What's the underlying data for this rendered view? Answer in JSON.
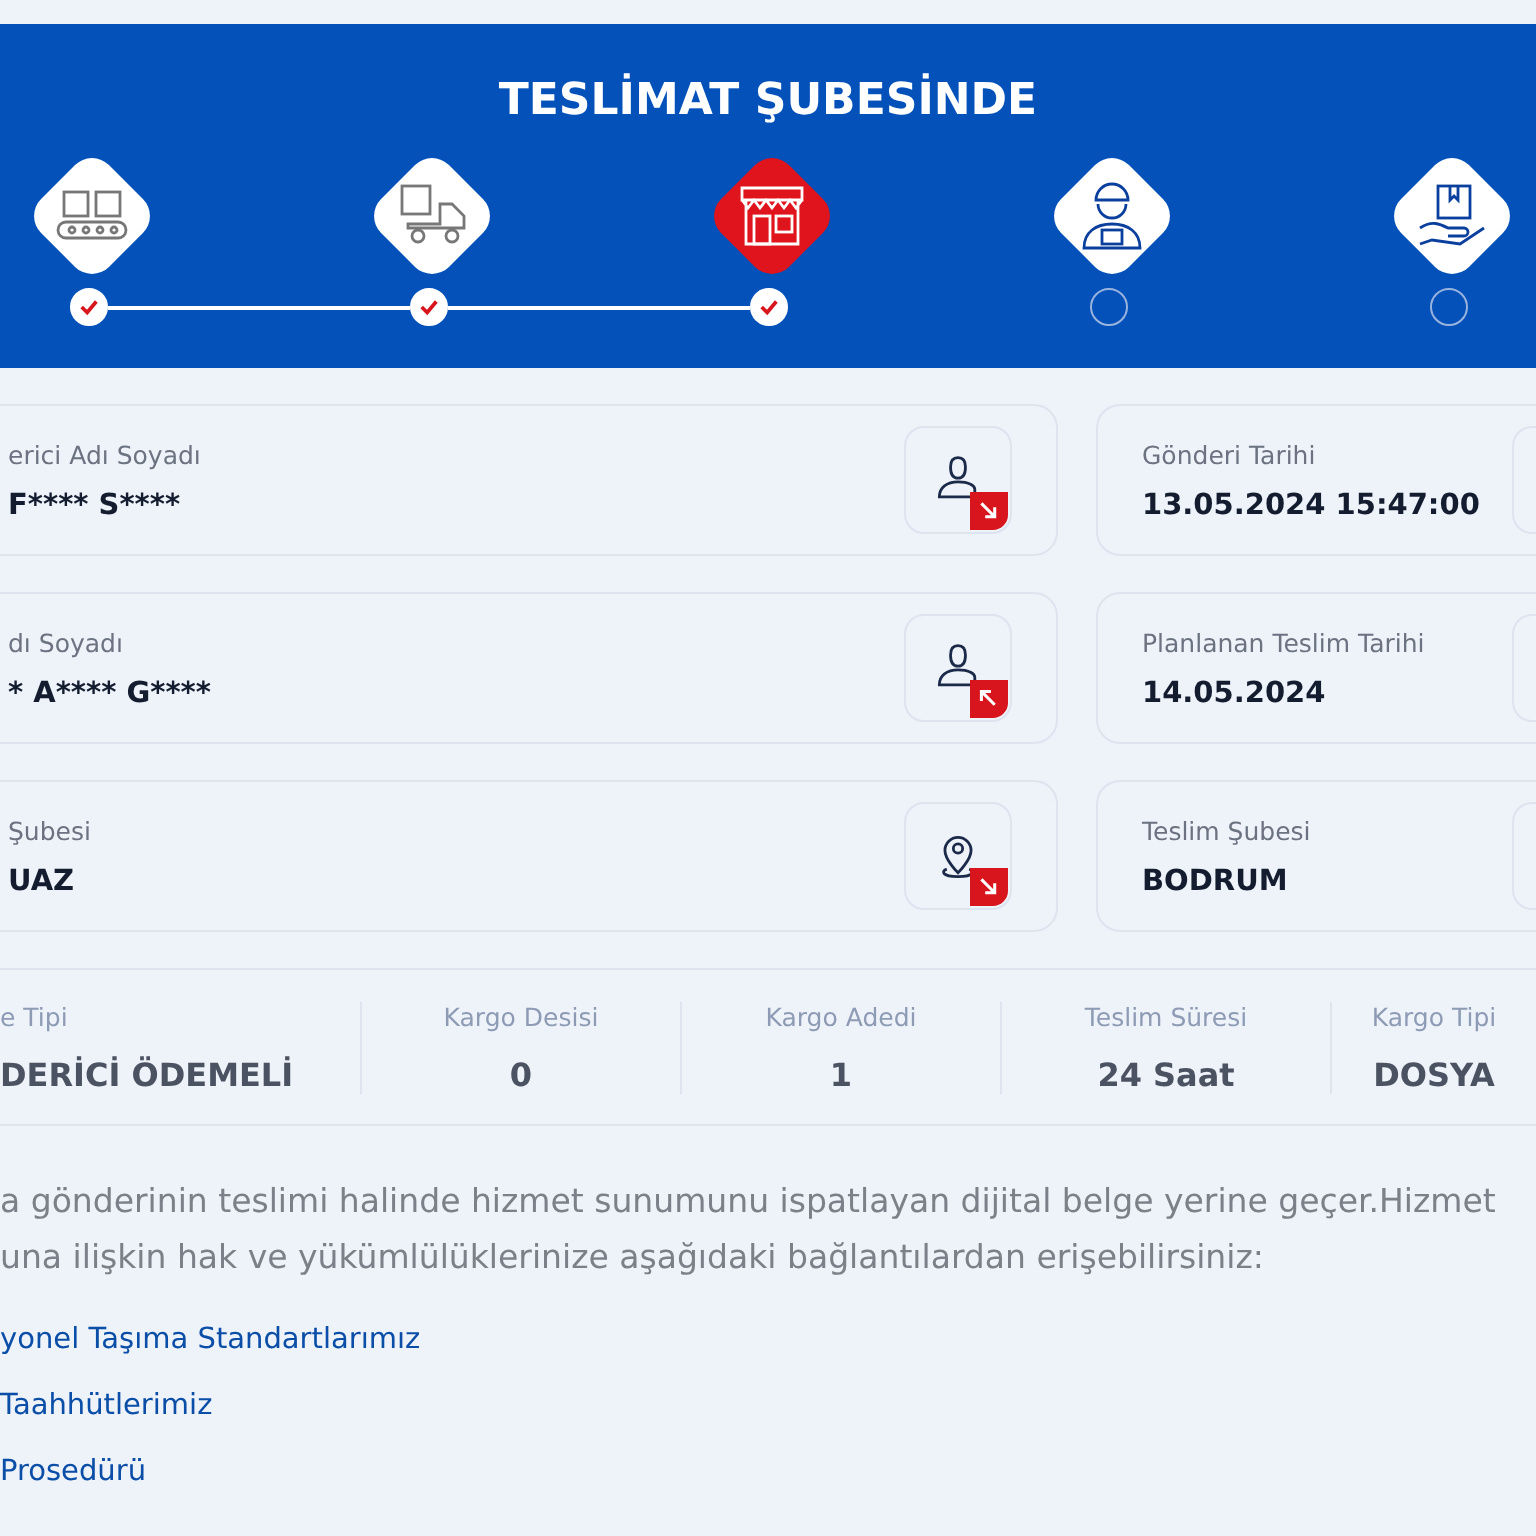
{
  "banner": {
    "title": "TESLİMAT ŞUBESİNDE"
  },
  "steps": [
    {
      "kind": "conveyor",
      "done": true,
      "current": false
    },
    {
      "kind": "truck",
      "done": true,
      "current": false
    },
    {
      "kind": "store",
      "done": true,
      "current": true
    },
    {
      "kind": "courier",
      "done": false,
      "current": false
    },
    {
      "kind": "hand-box",
      "done": false,
      "current": false
    }
  ],
  "left_cards": [
    {
      "label": "erici Adı Soyadı",
      "value": "F**** S****",
      "kind": "sender"
    },
    {
      "label": "dı Soyadı",
      "value": "* A**** G****",
      "kind": "receiver"
    },
    {
      "label": "Şubesi",
      "value": "UAZ",
      "kind": "branch"
    }
  ],
  "right_cards": [
    {
      "label": "Gönderi Tarihi",
      "value": "13.05.2024 15:47:00"
    },
    {
      "label": "Planlanan Teslim Tarihi",
      "value": "14.05.2024"
    },
    {
      "label": "Teslim Şubesi",
      "value": "BODRUM"
    }
  ],
  "stats": [
    {
      "label": "e Tipi",
      "value": "DERİCİ ÖDEMELİ"
    },
    {
      "label": "Kargo Desisi",
      "value": "0"
    },
    {
      "label": "Kargo Adedi",
      "value": "1"
    },
    {
      "label": "Teslim Süresi",
      "value": "24 Saat"
    },
    {
      "label": "Kargo Tipi",
      "value": "DOSYA"
    }
  ],
  "notice_lines": [
    "a gönderinin teslimi halinde hizmet sunumunu ispatlayan dijital belge yerine geçer.Hizmet",
    "una ilişkin hak ve yükümlülüklerinize aşağıdaki bağlantılardan erişebilirsiniz:"
  ],
  "links": [
    "yonel Taşıma Standartlarımız",
    "Taahhütlerimiz",
    "Prosedürü"
  ]
}
